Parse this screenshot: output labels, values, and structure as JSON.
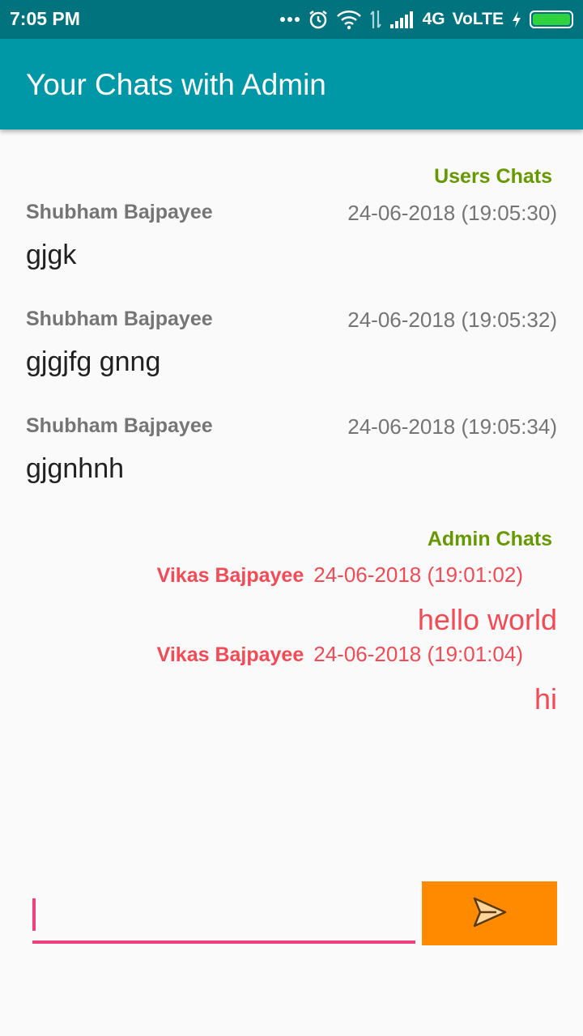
{
  "status_bar": {
    "time": "7:05 PM",
    "network": "4G",
    "volte": "VoLTE",
    "icons": [
      "more-icon",
      "alarm-icon",
      "wifi-icon",
      "data-arrows-icon",
      "signal-icon",
      "charging-icon",
      "battery-icon"
    ]
  },
  "app_bar": {
    "title": "Your Chats with Admin"
  },
  "users_section": {
    "header": "Users Chats",
    "messages": [
      {
        "sender": "Shubham Bajpayee",
        "time": "24-06-2018 (19:05:30)",
        "text": "gjgk"
      },
      {
        "sender": "Shubham Bajpayee",
        "time": "24-06-2018 (19:05:32)",
        "text": "gjgjfg gnng"
      },
      {
        "sender": "Shubham Bajpayee",
        "time": "24-06-2018 (19:05:34)",
        "text": "gjgnhnh"
      }
    ]
  },
  "admin_section": {
    "header": "Admin Chats",
    "messages": [
      {
        "sender": "Vikas Bajpayee",
        "time": "24-06-2018 (19:01:02)",
        "text": "hello world"
      },
      {
        "sender": "Vikas Bajpayee",
        "time": "24-06-2018 (19:01:04)",
        "text": "hi"
      }
    ]
  },
  "composer": {
    "input_value": "",
    "send_icon": "send-icon"
  },
  "colors": {
    "status_bar": "#00737e",
    "app_bar": "#0097a7",
    "users_header": "#669900",
    "admin_text": "#f44a55",
    "input_underline": "#f0407d",
    "send_button": "#ff8a00",
    "battery": "#2fd33f"
  }
}
